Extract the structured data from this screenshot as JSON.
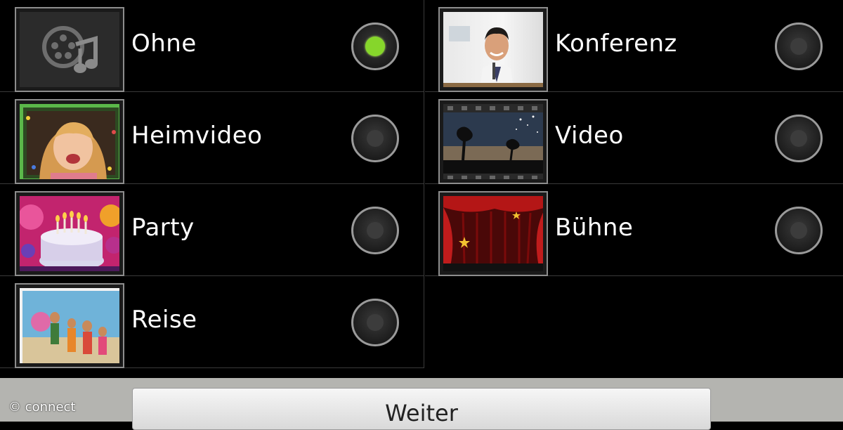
{
  "options": [
    {
      "label": "Ohne",
      "thumbnail": "film-music-icon",
      "selected": true
    },
    {
      "label": "Konferenz",
      "thumbnail": "conference-photo",
      "selected": false
    },
    {
      "label": "Heimvideo",
      "thumbnail": "child-photo",
      "selected": false
    },
    {
      "label": "Video",
      "thumbnail": "film-strip-silhouette",
      "selected": false
    },
    {
      "label": "Party",
      "thumbnail": "birthday-cake-photo",
      "selected": false
    },
    {
      "label": "Bühne",
      "thumbnail": "red-curtain-stage",
      "selected": false
    },
    {
      "label": "Reise",
      "thumbnail": "family-beach-photo",
      "selected": false
    }
  ],
  "footer": {
    "button_label": "Weiter",
    "watermark": "© connect"
  },
  "colors": {
    "background": "#000000",
    "selected_radio": "#86d62b",
    "divider": "#3a3a3a",
    "footer": "#b4b4b0"
  }
}
